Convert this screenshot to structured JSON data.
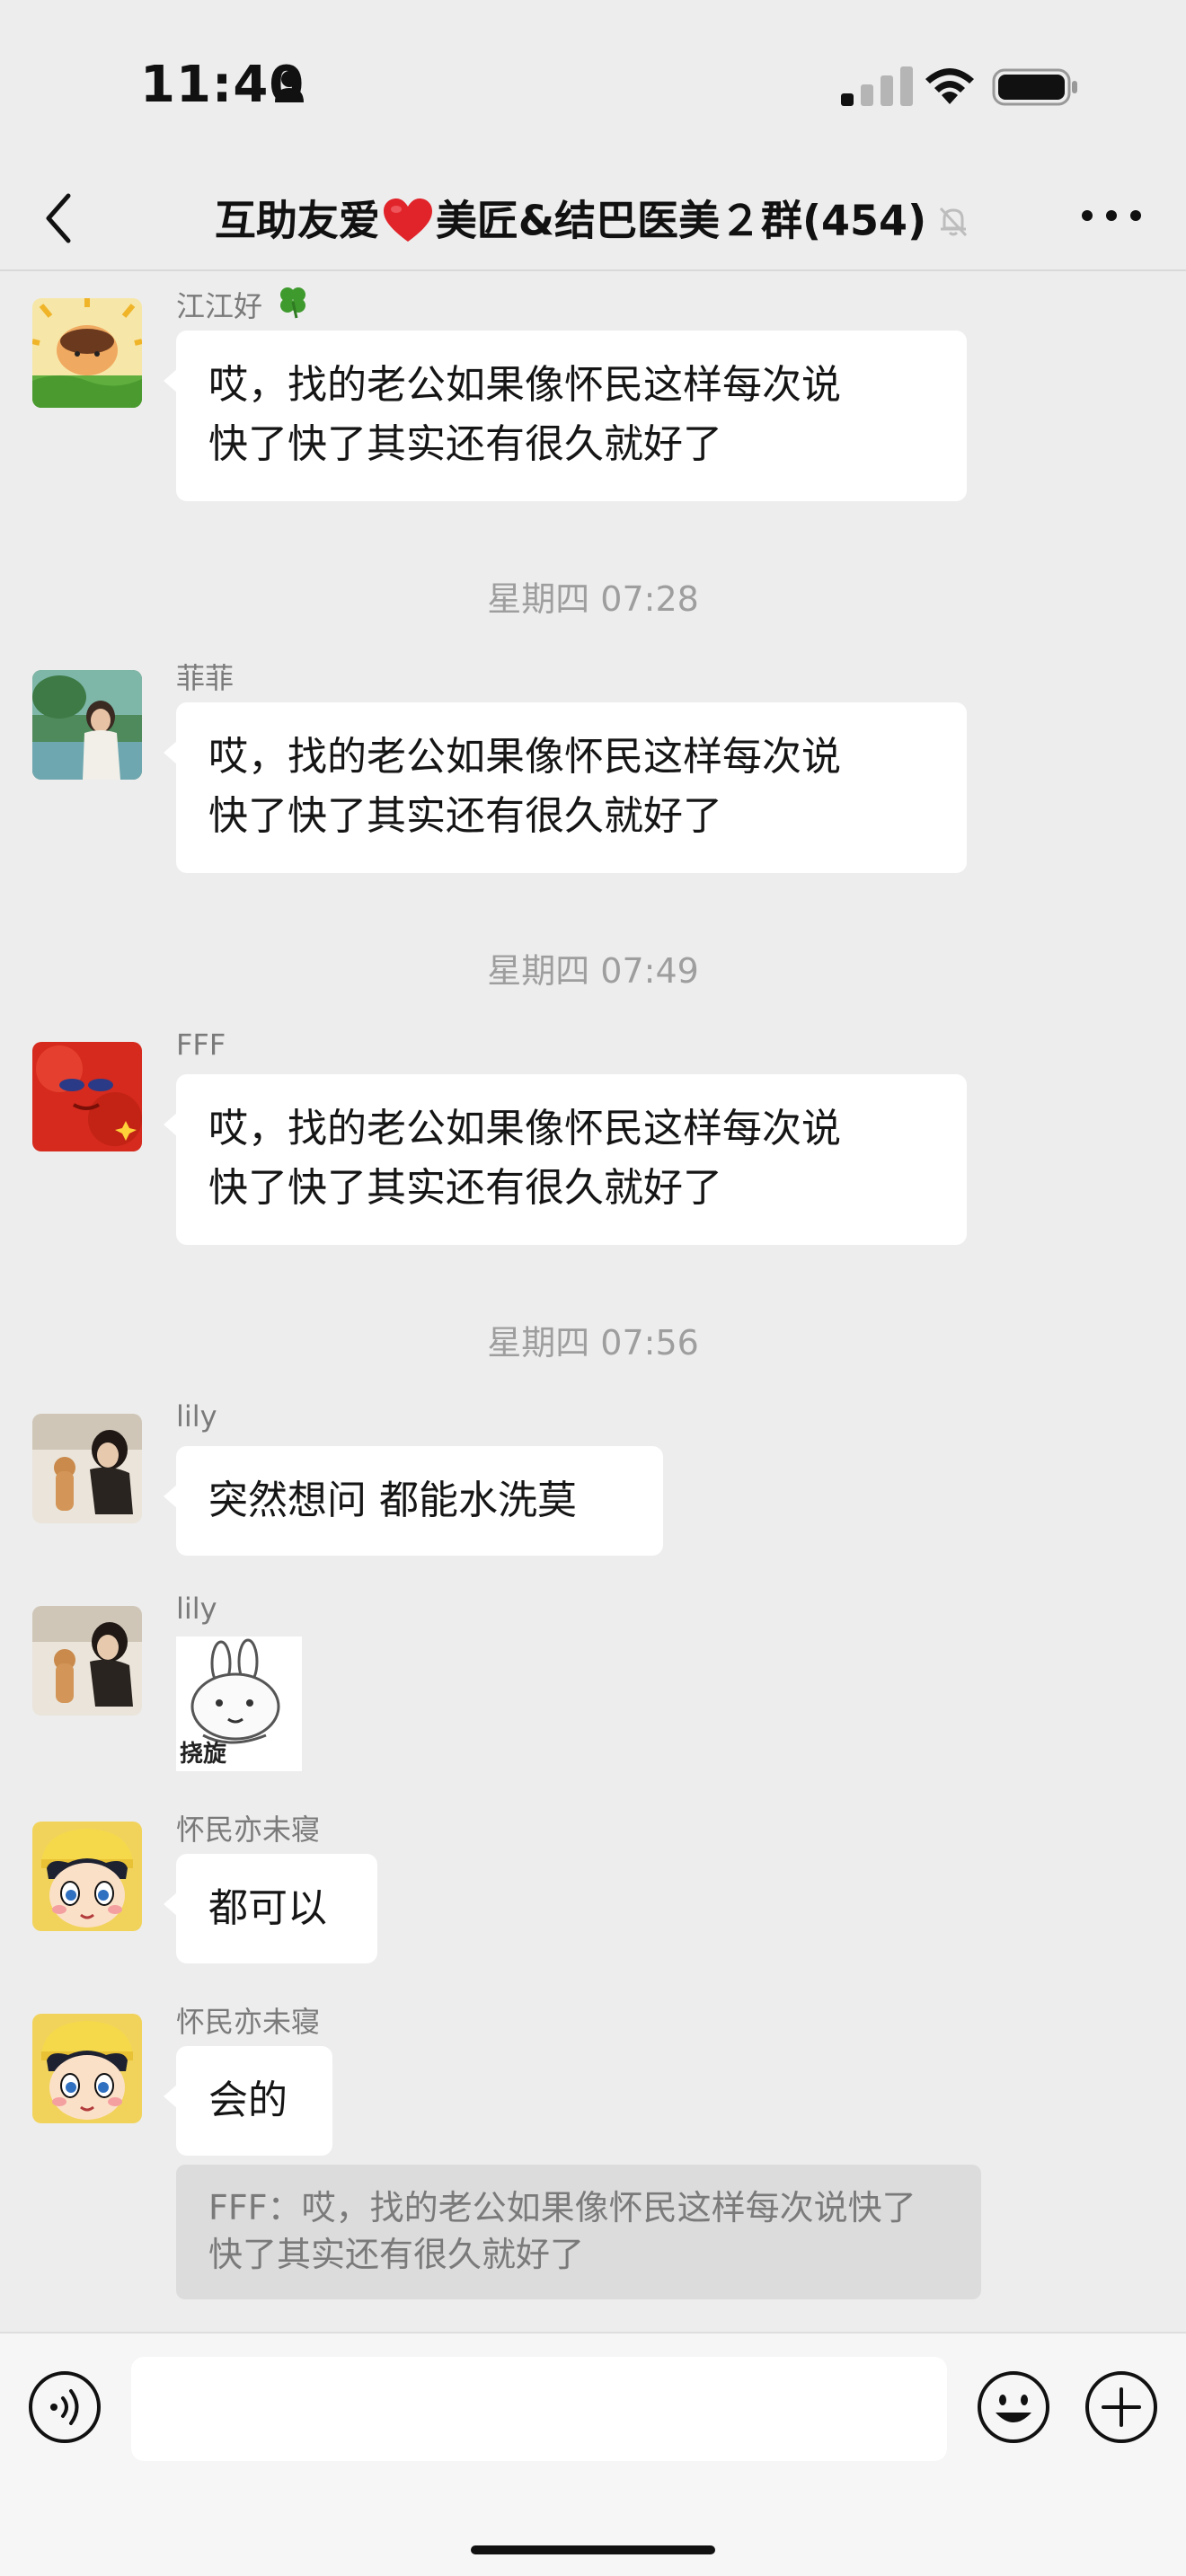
{
  "status": {
    "time": "11:40"
  },
  "nav": {
    "title_part1": "互助友爱",
    "title_part2": "美匠&结巴医美２群(454)"
  },
  "messages": [
    {
      "sender": "江江好",
      "text": "哎，找的老公如果像怀民这样每次说\n快了快了其实还有很久就好了"
    },
    {
      "timestamp": "星期四 07:28"
    },
    {
      "sender": "菲菲",
      "text": "哎，找的老公如果像怀民这样每次说\n快了快了其实还有很久就好了"
    },
    {
      "timestamp": "星期四 07:49"
    },
    {
      "sender": "FFF",
      "text": "哎，找的老公如果像怀民这样每次说\n快了快了其实还有很久就好了"
    },
    {
      "timestamp": "星期四 07:56"
    },
    {
      "sender": "lily",
      "text": "突然想问 都能水洗莫"
    },
    {
      "sender": "lily",
      "sticker_caption": "挠旋"
    },
    {
      "sender": "怀民亦未寝",
      "text": "都可以"
    },
    {
      "sender": "怀民亦未寝",
      "text": "会的"
    }
  ],
  "quote": {
    "text": "FFF：哎，找的老公如果像怀民这样每次说快了快了其实还有很久就好了"
  },
  "colors": {
    "background": "#ededed",
    "bubble": "#ffffff",
    "quote_bg": "#dcdcdc",
    "heart": "#e0242a"
  }
}
